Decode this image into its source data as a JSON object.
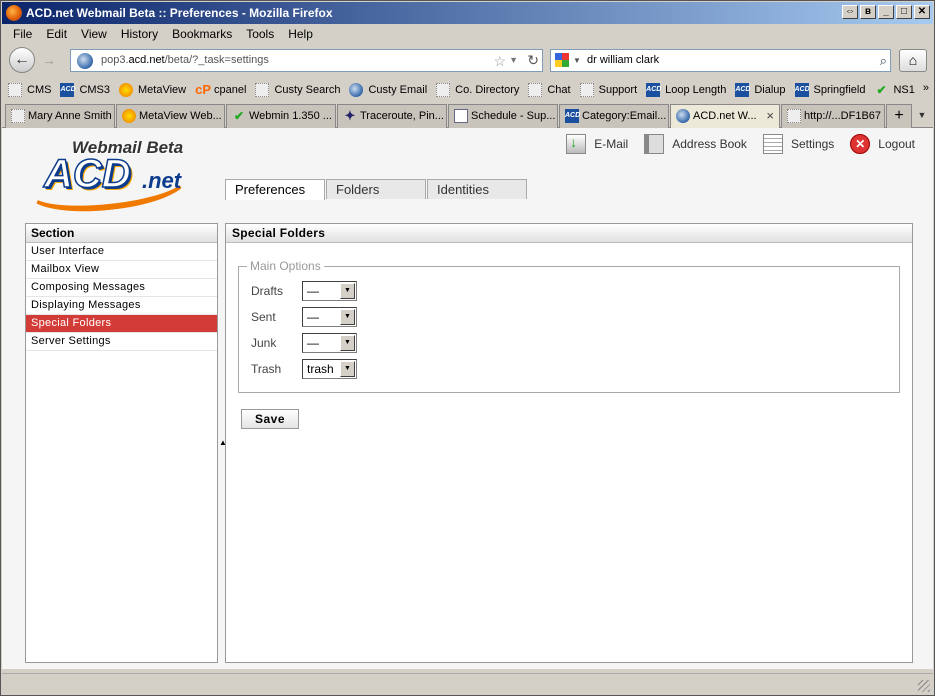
{
  "window": {
    "title": "ACD.net Webmail Beta :: Preferences - Mozilla Firefox"
  },
  "menu": [
    "File",
    "Edit",
    "View",
    "History",
    "Bookmarks",
    "Tools",
    "Help"
  ],
  "nav": {
    "url_prefix": "pop3.",
    "url_domain": "acd.net",
    "url_path": "/beta/?_task=settings",
    "search_value": "dr william clark"
  },
  "bookmarks": [
    {
      "label": "CMS",
      "icon": "blank-page-icon"
    },
    {
      "label": "CMS3",
      "icon": "acd-icon"
    },
    {
      "label": "MetaView",
      "icon": "metaview-icon"
    },
    {
      "label": "cpanel",
      "icon": "cpanel-icon"
    },
    {
      "label": "Custy Search",
      "icon": "blank-page-icon"
    },
    {
      "label": "Custy Email",
      "icon": "globe-icon"
    },
    {
      "label": "Co. Directory",
      "icon": "blank-page-icon"
    },
    {
      "label": "Chat",
      "icon": "blank-page-icon"
    },
    {
      "label": "Support",
      "icon": "blank-page-icon"
    },
    {
      "label": "Loop Length",
      "icon": "acd-icon"
    },
    {
      "label": "Dialup",
      "icon": "acd-icon"
    },
    {
      "label": "Springfield",
      "icon": "acd-icon"
    },
    {
      "label": "NS1",
      "icon": "webmin-icon"
    }
  ],
  "tabs": [
    {
      "label": "Mary Anne Smith",
      "icon": "blank-page-icon"
    },
    {
      "label": "MetaView Web...",
      "icon": "metaview-icon"
    },
    {
      "label": "Webmin 1.350 ...",
      "icon": "webmin-icon"
    },
    {
      "label": "Traceroute, Pin...",
      "icon": "traceroute-icon"
    },
    {
      "label": "Schedule - Sup...",
      "icon": "schedule-icon"
    },
    {
      "label": "Category:Email...",
      "icon": "acd-icon"
    },
    {
      "label": "ACD.net W...",
      "icon": "globe-icon",
      "active": true
    },
    {
      "label": "http://...DF1B67",
      "icon": "blank-page-icon"
    }
  ],
  "app": {
    "logo_top": "Webmail Beta",
    "logo_main": "ACD",
    "logo_suffix": ".net",
    "topnav": [
      {
        "label": "E-Mail",
        "icon": "mail-icon"
      },
      {
        "label": "Address Book",
        "icon": "address-book-icon"
      },
      {
        "label": "Settings",
        "icon": "settings-icon"
      },
      {
        "label": "Logout",
        "icon": "logout-icon"
      }
    ],
    "pref_tabs": [
      {
        "label": "Preferences",
        "active": true
      },
      {
        "label": "Folders"
      },
      {
        "label": "Identities"
      }
    ],
    "section": {
      "title": "Section",
      "items": [
        "User Interface",
        "Mailbox View",
        "Composing Messages",
        "Displaying Messages",
        "Special Folders",
        "Server Settings"
      ],
      "active_index": 4
    },
    "main": {
      "title": "Special Folders",
      "legend": "Main Options",
      "fields": [
        {
          "label": "Drafts",
          "value": "—"
        },
        {
          "label": "Sent",
          "value": "—"
        },
        {
          "label": "Junk",
          "value": "—"
        },
        {
          "label": "Trash",
          "value": "trash"
        }
      ],
      "save_label": "Save"
    },
    "accent_color": "#d33b37"
  }
}
